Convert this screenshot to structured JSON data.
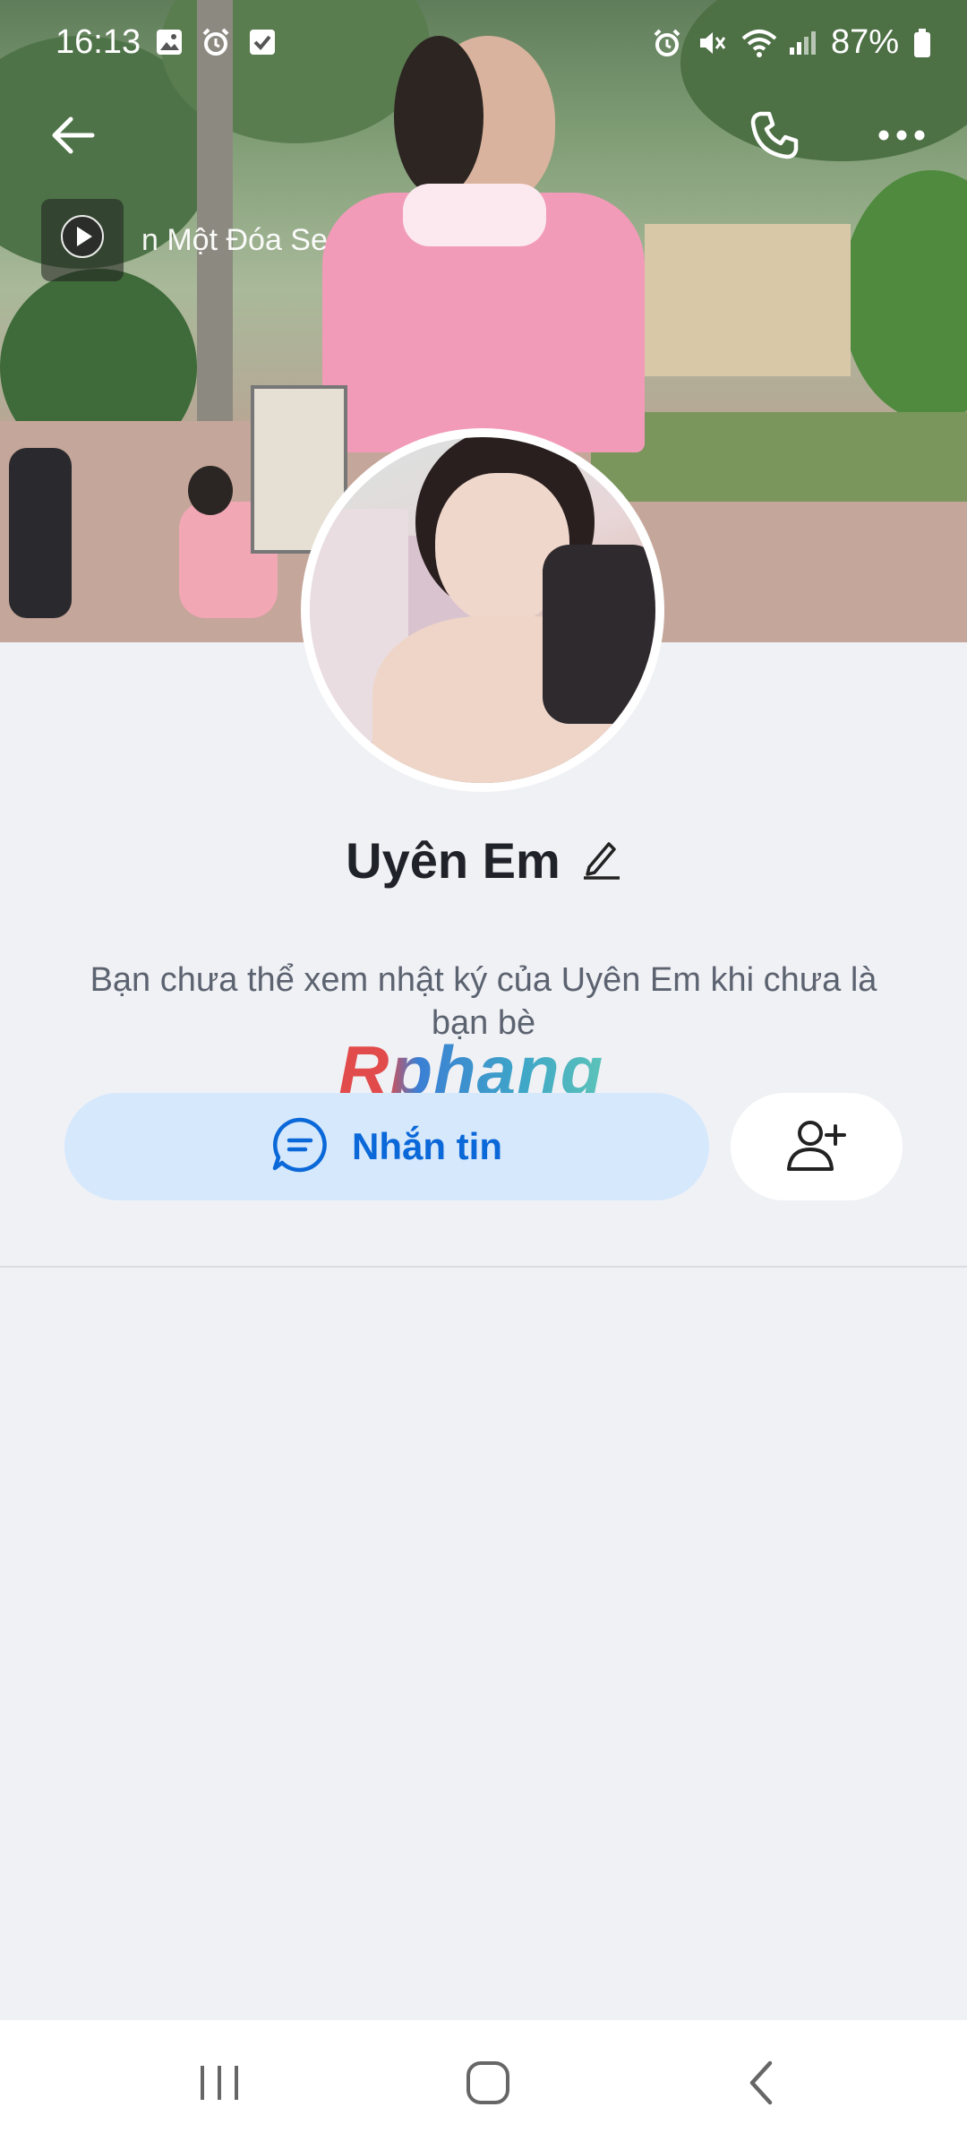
{
  "status_bar": {
    "time": "16:13",
    "battery": "87%",
    "left_icons": [
      "image-icon",
      "alarm-icon",
      "check-box-icon"
    ],
    "right_icons": [
      "alarm-icon",
      "mute-icon",
      "wifi-icon",
      "signal-icon",
      "battery-icon"
    ]
  },
  "header": {
    "back_icon": "arrow-left-icon",
    "call_icon": "phone-icon",
    "more_icon": "more-horizontal-icon"
  },
  "music": {
    "title": "n Một Đóa Se",
    "play_icon": "play-icon"
  },
  "profile": {
    "name": "Uyên Em",
    "edit_icon": "pencil-icon",
    "notice": "Bạn chưa thể xem nhật ký của Uyên Em khi chưa là bạn bè"
  },
  "watermark": "Rphang",
  "actions": {
    "message_label": "Nhắn tin",
    "message_icon": "chat-bubble-icon",
    "add_friend_icon": "user-plus-icon"
  },
  "nav": {
    "recent_icon": "recent-apps-icon",
    "home_icon": "home-icon",
    "back_icon": "back-chevron-icon"
  },
  "colors": {
    "accent": "#0a68d8",
    "message_button_bg": "#d6e8fc",
    "page_bg": "#f0f1f5"
  }
}
